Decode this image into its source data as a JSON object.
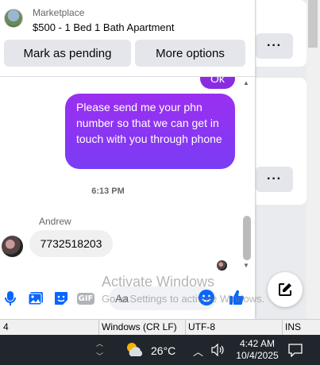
{
  "marketplace": {
    "label": "Marketplace",
    "listing_title": "$500 - 1 Bed 1 Bath Apartment",
    "mark_pending_label": "Mark as pending",
    "more_options_label": "More options"
  },
  "background": {
    "more_label_1": "···",
    "more_label_2": "···"
  },
  "messages": {
    "previous_text": "Ok",
    "outgoing_text": "Please send me your phn number so that we can get in touch with you through phone",
    "timestamp": "6:13 PM",
    "incoming_sender": "Andrew",
    "incoming_text": "7732518203"
  },
  "composer": {
    "placeholder": "Aa",
    "gif_label": "GIF"
  },
  "watermark": {
    "title": "Activate Windows",
    "subtitle": "Go to Settings to activate Windows."
  },
  "statusbar": {
    "column": "4",
    "line_ending": "Windows (CR LF)",
    "encoding": "UTF-8",
    "insert_mode": "INS"
  },
  "taskbar": {
    "temperature": "26°C",
    "time": "4:42 AM",
    "date": "10/4/2025"
  },
  "colors": {
    "bubble_gradient_top": "#9b2ff0",
    "bubble_gradient_bottom": "#7a3cf5",
    "accent_blue": "#0866ff"
  }
}
